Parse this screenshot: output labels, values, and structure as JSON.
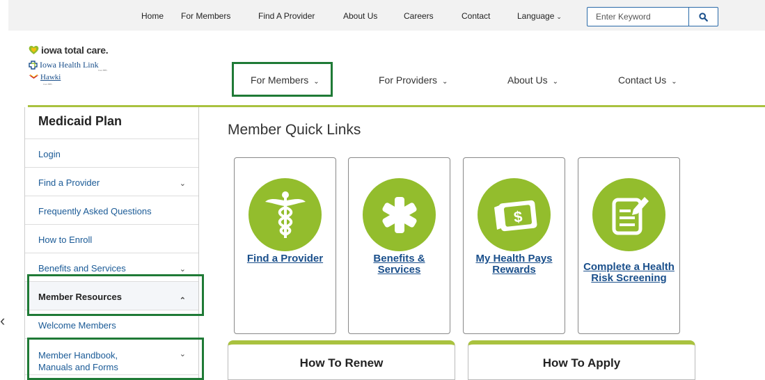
{
  "utility_nav": {
    "links": [
      "Home",
      "For Members",
      "Find A Provider",
      "About Us",
      "Careers",
      "Contact"
    ],
    "language_label": "Language",
    "search_placeholder": "Enter Keyword"
  },
  "logo": {
    "brand": "iowa total care.",
    "program_1": "Iowa Health Link",
    "program_1_sub": "Iowa HHS",
    "program_2": "Hawki",
    "program_2_sub": "Iowa HHS"
  },
  "main_nav": {
    "items": [
      "For Members",
      "For Providers",
      "About Us",
      "Contact Us"
    ]
  },
  "sidebar": {
    "title": "Medicaid Plan",
    "items": [
      {
        "label": "Login"
      },
      {
        "label": "Find a Provider"
      },
      {
        "label": "Frequently Asked Questions"
      },
      {
        "label": "How to Enroll"
      },
      {
        "label": "Benefits and Services"
      },
      {
        "label": "Member Resources"
      },
      {
        "label": "Welcome Members"
      },
      {
        "label": "Member Handbook, Manuals and Forms"
      }
    ]
  },
  "content": {
    "title": "Member Quick Links",
    "cards": [
      {
        "label": "Find a Provider",
        "icon": "caduceus-icon"
      },
      {
        "label": "Benefits & Services",
        "icon": "asterisk-icon"
      },
      {
        "label": "My Health Pays Rewards",
        "icon": "money-icon"
      },
      {
        "label": "Complete a Health Risk Screening",
        "icon": "clipboard-edit-icon"
      }
    ],
    "bottom_cards": [
      "How To Renew",
      "How To Apply"
    ]
  },
  "colors": {
    "accent_green": "#93bd2d",
    "highlight_border": "#1f7a36",
    "link_blue": "#1a4f8b"
  }
}
